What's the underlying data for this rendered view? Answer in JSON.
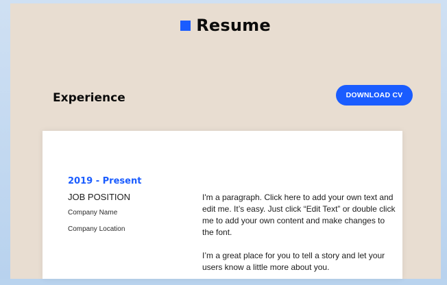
{
  "header": {
    "title": "Resume"
  },
  "section": {
    "title": "Experience",
    "download_label": "DOWNLOAD CV"
  },
  "entry": {
    "period": "2019 - Present",
    "position": "JOB POSITION",
    "company": "Company Name",
    "location": "Company Location",
    "paragraph1": "I'm a paragraph. Click here to add your own text and edit me. It’s easy. Just click “Edit Text” or double click me to add your own content and make changes to the font.",
    "paragraph2": "I’m a great place for you to tell a story and let your users know a little more about you."
  },
  "colors": {
    "accent": "#1a5cff",
    "panel": "#e8ddd1",
    "card": "#ffffff"
  }
}
